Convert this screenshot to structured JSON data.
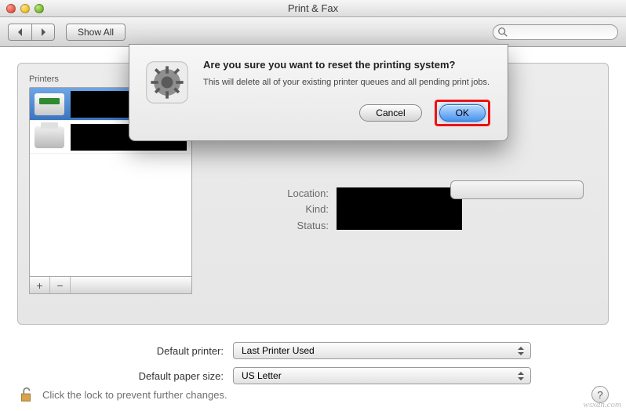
{
  "window": {
    "title": "Print & Fax"
  },
  "toolbar": {
    "show_all": "Show All",
    "search_placeholder": ""
  },
  "sidebar": {
    "header": "Printers",
    "add_label": "+",
    "remove_label": "−"
  },
  "details": {
    "location_label": "Location:",
    "kind_label": "Kind:",
    "status_label": "Status:"
  },
  "defaults": {
    "printer_label": "Default printer:",
    "printer_value": "Last Printer Used",
    "papersize_label": "Default paper size:",
    "papersize_value": "US Letter"
  },
  "footer": {
    "lock_text": "Click the lock to prevent further changes."
  },
  "dialog": {
    "title": "Are you sure you want to reset the printing system?",
    "message": "This will delete all of your existing printer queues and all pending print jobs.",
    "cancel": "Cancel",
    "ok": "OK"
  },
  "watermark": "wsxdn.com"
}
